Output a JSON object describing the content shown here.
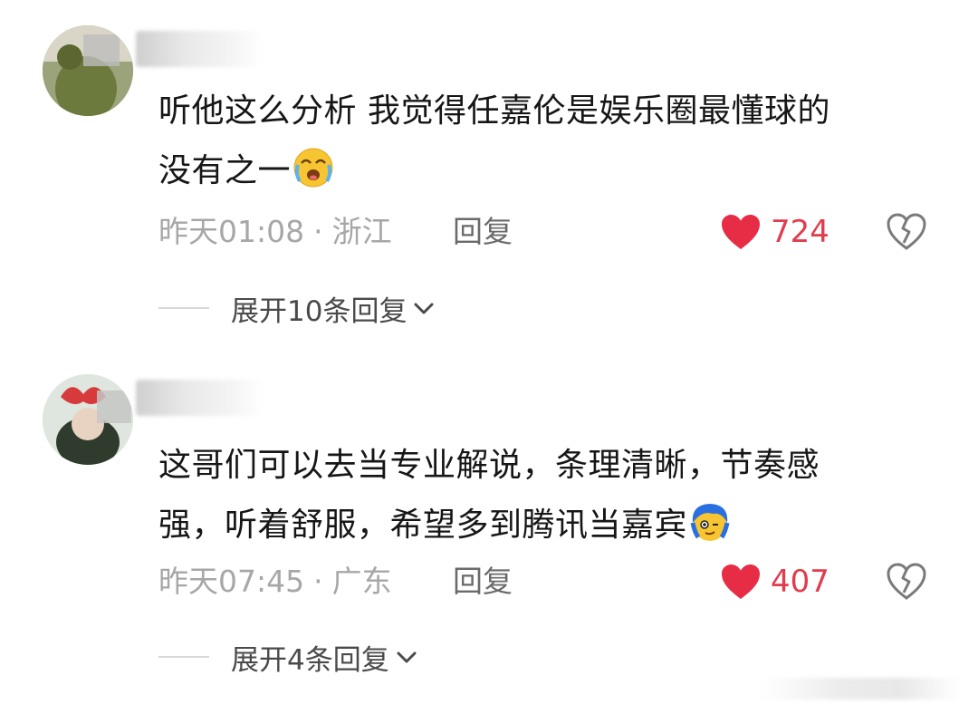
{
  "comments": [
    {
      "text_line1": "听他这么分析 我觉得任嘉伦是娱乐圈最懂球的",
      "text_line2": "没有之一",
      "emoji": "crying-face-emoji",
      "time": "昨天01:08",
      "separator": "·",
      "location": "浙江",
      "reply_label": "回复",
      "likes": "724",
      "expand_label": "展开10条回复"
    },
    {
      "text_line1": "这哥们可以去当专业解说，条理清晰，节奏感",
      "text_line2": "强，听着舒服，希望多到腾讯当嘉宾",
      "emoji": "blue-hair-emoji",
      "time": "昨天07:45",
      "separator": "·",
      "location": "广东",
      "reply_label": "回复",
      "likes": "407",
      "expand_label": "展开4条回复"
    }
  ],
  "colors": {
    "like_red": "#e13c4d",
    "meta_gray": "#a7a7a7",
    "text": "#161616"
  }
}
